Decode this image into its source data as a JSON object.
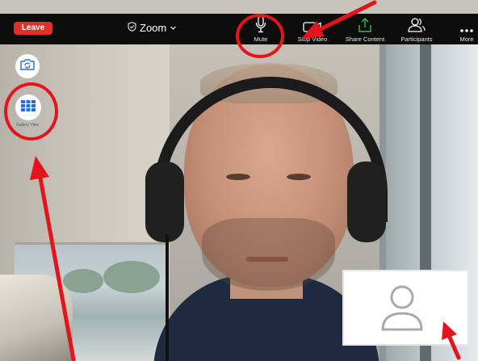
{
  "toolbar": {
    "leave_label": "Leave",
    "app_title": "Zoom",
    "items": [
      {
        "label": "Mute",
        "icon": "microphone-icon"
      },
      {
        "label": "Stop Video",
        "icon": "video-camera-icon"
      },
      {
        "label": "Share Content",
        "icon": "share-screen-icon"
      },
      {
        "label": "Participants",
        "icon": "participants-icon"
      },
      {
        "label": "More",
        "icon": "more-dots-icon"
      }
    ]
  },
  "side_controls": {
    "switch_camera_icon": "camera-switch-icon",
    "gallery_view_label": "Gallery View",
    "gallery_view_icon": "gallery-grid-icon"
  },
  "self_view": {
    "icon": "avatar-placeholder-icon"
  },
  "colors": {
    "leave_red": "#e0302b",
    "toolbar_bg": "#0d0d0d",
    "share_green": "#2fbf4f",
    "gallery_blue": "#1f6fe0",
    "annotation_red": "#e3141b"
  }
}
